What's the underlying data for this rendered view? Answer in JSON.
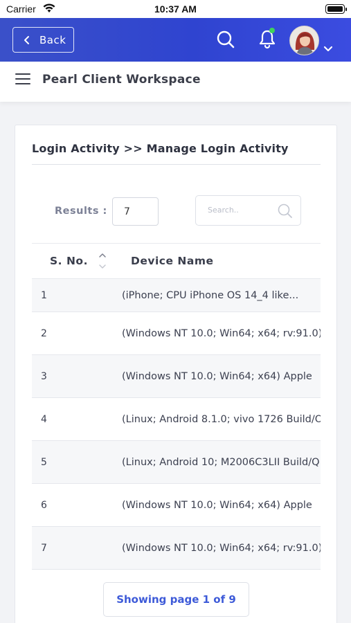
{
  "status_bar": {
    "carrier": "Carrier",
    "time": "10:37 AM"
  },
  "header": {
    "back_label": "Back",
    "brand_color": "#3348cf",
    "notification_dot_color": "#3ed15c",
    "icons": [
      "chevron-left-icon",
      "search-icon",
      "bell-icon",
      "avatar",
      "chevron-down-icon"
    ]
  },
  "subheader": {
    "title": "Pearl Client Workspace"
  },
  "card": {
    "breadcrumb": "Login Activity >> Manage Login Activity",
    "results_label": "Results :",
    "results_value": "7",
    "search_placeholder": "Search..",
    "table": {
      "columns": [
        "S. No.",
        "Device Name"
      ],
      "rows": [
        {
          "sno": "1",
          "device": "(iPhone; CPU iPhone OS 14_4 like..."
        },
        {
          "sno": "2",
          "device": "(Windows NT 10.0; Win64; x64; rv:91.0)"
        },
        {
          "sno": "3",
          "device": "(Windows NT 10.0; Win64; x64) Apple"
        },
        {
          "sno": "4",
          "device": "(Linux; Android 8.1.0; vivo 1726 Build/O"
        },
        {
          "sno": "5",
          "device": "(Linux; Android 10; M2006C3LII Build/Q"
        },
        {
          "sno": "6",
          "device": "(Windows NT 10.0; Win64; x64) Apple"
        },
        {
          "sno": "7",
          "device": "(Windows NT 10.0; Win64; x64; rv:91.0)"
        }
      ]
    },
    "pager_text": "Showing page 1 of 9"
  }
}
